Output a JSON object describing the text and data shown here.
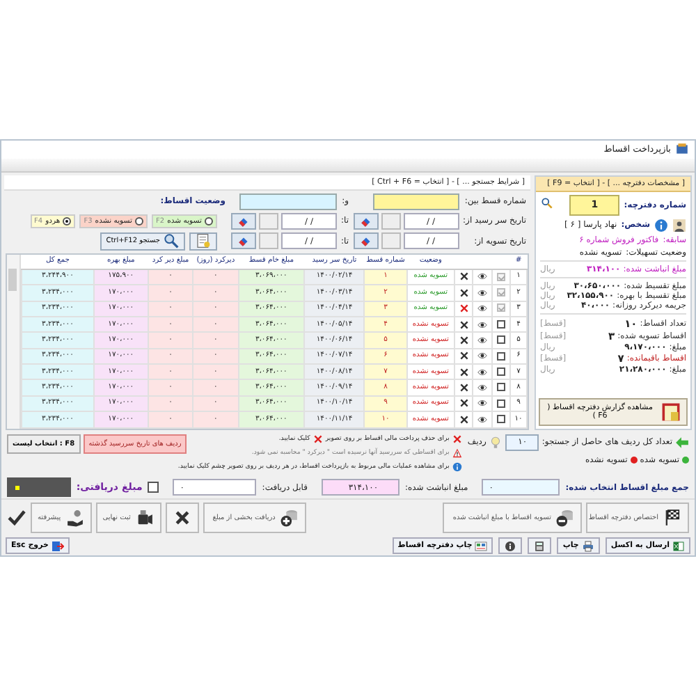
{
  "window": {
    "title": "بازپرداخت اقساط"
  },
  "booklet": {
    "header": "[ مشخصات دفترچه ... ] - [ انتخاب = F9 ]",
    "number_label": "شماره دفترچه:",
    "number": "1",
    "person_label": "شخص:",
    "person": "نهاد پارسا [ ۶ ]",
    "record_label": "سابقه:",
    "record": "فاکتور فروش شماره ۶",
    "status_label": "وضعیت تسهیلات:",
    "status": "تسویه نشده",
    "groups": [
      [
        {
          "label": "مبلغ انباشت شده:",
          "value": "۳۱۴،۱۰۰",
          "unit": "ریال",
          "kind": "accent"
        }
      ],
      [
        {
          "label": "مبلغ تقسیط شده:",
          "value": "۳۰،۶۵۰،۰۰۰",
          "unit": "ریال",
          "kind": "plain"
        },
        {
          "label": "مبلغ تقسیط با بهره:",
          "value": "۳۲،۱۵۵،۹۰۰",
          "unit": "ریال",
          "kind": "plain"
        },
        {
          "label": "جریمه دیرکرد روزانه:",
          "value": "۴۰،۰۰۰",
          "unit": "ریال",
          "kind": "plain"
        }
      ],
      [
        {
          "label": "تعداد اقساط:",
          "value": "۱۰",
          "unit": "[قسط]",
          "kind": "count"
        },
        {
          "label": "اقساط تسویه شده:",
          "value": "۳",
          "unit": "[قسط]",
          "kind": "count"
        },
        {
          "label": "مبلغ:",
          "value": "۹،۱۷۰،۰۰۰",
          "unit": "ریال",
          "kind": "plain"
        },
        {
          "label": "اقساط باقیمانده:",
          "value": "۷",
          "unit": "[قسط]",
          "kind": "warn"
        },
        {
          "label": "مبلغ:",
          "value": "۲۱،۲۸۰،۰۰۰",
          "unit": "ریال",
          "kind": "plain"
        }
      ]
    ],
    "report_button": "مشاهده گزارش دفترچه اقساط ( F6 )"
  },
  "search": {
    "header": "[ شرایط جستجو ... ] - [ انتخاب = Ctrl + F6 ]",
    "number_from_label": "شماره قسط بین:",
    "number_to_label": "و:",
    "status_label": "وضعیت اقساط:",
    "status_options": [
      {
        "label": "تسویه شده",
        "key": "F2",
        "color": "#d9f5c8",
        "selected": false
      },
      {
        "label": "تسویه نشده",
        "key": "F3",
        "color": "#fbd3c8",
        "selected": false
      },
      {
        "label": "هردو",
        "key": "F4",
        "color": "#fffbd0",
        "selected": true
      }
    ],
    "due_from_label": "تاریخ سر رسید از:",
    "due_from": "/  /",
    "due_to_label": "تا:",
    "due_to": "/  /",
    "settle_from_label": "تاریخ تسویه از:",
    "settle_from": "/  /",
    "settle_to_label": "تا:",
    "settle_to": "/  /",
    "search_button": {
      "label": "جستجو",
      "key": "Ctrl+F12"
    }
  },
  "table": {
    "columns": [
      "#",
      "وضعیت",
      "شماره قسط",
      "تاریخ سر رسید",
      "مبلغ خام قسط",
      "دیرکرد (روز)",
      "مبلغ دیر کرد",
      "مبلغ بهره",
      "جمع کل"
    ],
    "rows": [
      {
        "index": "۱",
        "checked": true,
        "settled": true,
        "current": false,
        "status": "تسویه شده",
        "number": "۱",
        "due": "۱۴۰۰/۰۲/۱۴",
        "raw": "۳،۰۶۹،۰۰۰",
        "delay": "۰",
        "late_fee": "۰",
        "interest": "۱۷۵،۹۰۰",
        "total": "۳،۲۴۴،۹۰۰"
      },
      {
        "index": "۲",
        "checked": true,
        "settled": true,
        "current": false,
        "status": "تسویه شده",
        "number": "۲",
        "due": "۱۴۰۰/۰۳/۱۴",
        "raw": "۳،۰۶۴،۰۰۰",
        "delay": "۰",
        "late_fee": "۰",
        "interest": "۱۷۰،۰۰۰",
        "total": "۳،۲۳۴،۰۰۰"
      },
      {
        "index": "۳",
        "checked": true,
        "settled": true,
        "current": true,
        "status": "تسویه شده",
        "number": "۳",
        "due": "۱۴۰۰/۰۴/۱۴",
        "raw": "۳،۰۶۴،۰۰۰",
        "delay": "۰",
        "late_fee": "۰",
        "interest": "۱۷۰،۰۰۰",
        "total": "۳،۲۳۴،۰۰۰"
      },
      {
        "index": "۴",
        "checked": false,
        "settled": false,
        "current": false,
        "status": "تسویه نشده",
        "number": "۴",
        "due": "۱۴۰۰/۰۵/۱۴",
        "raw": "۳،۰۶۴،۰۰۰",
        "delay": "۰",
        "late_fee": "۰",
        "interest": "۱۷۰،۰۰۰",
        "total": "۳،۲۳۴،۰۰۰"
      },
      {
        "index": "۵",
        "checked": false,
        "settled": false,
        "current": false,
        "status": "تسویه نشده",
        "number": "۵",
        "due": "۱۴۰۰/۰۶/۱۴",
        "raw": "۳،۰۶۴،۰۰۰",
        "delay": "۰",
        "late_fee": "۰",
        "interest": "۱۷۰،۰۰۰",
        "total": "۳،۲۳۴،۰۰۰"
      },
      {
        "index": "۶",
        "checked": false,
        "settled": false,
        "current": false,
        "status": "تسویه نشده",
        "number": "۶",
        "due": "۱۴۰۰/۰۷/۱۴",
        "raw": "۳،۰۶۴،۰۰۰",
        "delay": "۰",
        "late_fee": "۰",
        "interest": "۱۷۰،۰۰۰",
        "total": "۳،۲۳۴،۰۰۰"
      },
      {
        "index": "۷",
        "checked": false,
        "settled": false,
        "current": false,
        "status": "تسویه نشده",
        "number": "۷",
        "due": "۱۴۰۰/۰۸/۱۴",
        "raw": "۳،۰۶۴،۰۰۰",
        "delay": "۰",
        "late_fee": "۰",
        "interest": "۱۷۰،۰۰۰",
        "total": "۳،۲۳۴،۰۰۰"
      },
      {
        "index": "۸",
        "checked": false,
        "settled": false,
        "current": false,
        "status": "تسویه نشده",
        "number": "۸",
        "due": "۱۴۰۰/۰۹/۱۴",
        "raw": "۳،۰۶۴،۰۰۰",
        "delay": "۰",
        "late_fee": "۰",
        "interest": "۱۷۰،۰۰۰",
        "total": "۳،۲۳۴،۰۰۰"
      },
      {
        "index": "۹",
        "checked": false,
        "settled": false,
        "current": false,
        "status": "تسویه نشده",
        "number": "۹",
        "due": "۱۴۰۰/۱۰/۱۴",
        "raw": "۳،۰۶۴،۰۰۰",
        "delay": "۰",
        "late_fee": "۰",
        "interest": "۱۷۰،۰۰۰",
        "total": "۳،۲۳۴،۰۰۰"
      },
      {
        "index": "۱۰",
        "checked": false,
        "settled": false,
        "current": false,
        "status": "تسویه نشده",
        "number": "۱۰",
        "due": "۱۴۰۰/۱۱/۱۴",
        "raw": "۳،۰۶۴،۰۰۰",
        "delay": "۰",
        "late_fee": "۰",
        "interest": "۱۷۰،۰۰۰",
        "total": "۳،۲۳۴،۰۰۰"
      }
    ]
  },
  "result_count": {
    "label": "تعداد کل ردیف های حاصل از جستجو:",
    "value": "۱۰",
    "unit": "ردیف"
  },
  "legend": [
    {
      "label": "تسویه شده",
      "color": "#3cb43c"
    },
    {
      "label": "تسویه نشده",
      "color": "#e02020"
    }
  ],
  "hints": [
    {
      "kind": "delete",
      "before": "برای حذف پرداخت مالی اقساط بر روی تصویر",
      "after": "کلیک نمایید."
    },
    {
      "kind": "warning",
      "before": "برای اقساطی که سررسید آنها نرسیده است \" دیرکرد \" محاسبه نمی شود."
    },
    {
      "kind": "info",
      "before": "برای مشاهده عملیات مالی مربوط به بازپرداخت اقساط، در هر ردیف بر روی تصویر چشم کلیک نمایید."
    }
  ],
  "overdue_button": "ردیف های تاریخ سررسید گذشته",
  "select_list_button": "F8 : انتخاب لیست",
  "totals": {
    "selected_label": "جمع مبلغ اقساط انتخاب شده:",
    "selected": "۰",
    "accumulated_label": "مبلغ انباشت شده:",
    "accumulated": "۳۱۴،۱۰۰",
    "receivable_label": "قابل دریافت:",
    "receivable": "۰",
    "received_label": "مبلغ دریافتی:",
    "received_checked": false
  },
  "actions": [
    {
      "kind": "flag",
      "label": "اختصاص دفترچه اقساط"
    },
    {
      "kind": "coins-minus",
      "label": "تسویه اقساط با مبلغ انباشت شده"
    },
    {
      "kind": "coins-plus",
      "label": "دریافت بخشی از مبلغ"
    },
    {
      "kind": "cancel"
    },
    {
      "kind": "camera",
      "label": "ثبت نهایی"
    },
    {
      "kind": "hand",
      "label": "پیشرفته"
    },
    {
      "kind": "confirm"
    }
  ],
  "bottom": [
    {
      "kind": "excel",
      "label": "ارسال به اکسل"
    },
    {
      "kind": "print",
      "label": "چاپ"
    },
    {
      "kind": "calculator"
    },
    {
      "kind": "help"
    },
    {
      "kind": "booklet",
      "label": "چاپ دفترچه اقساط"
    }
  ],
  "exit": {
    "label": "خروج",
    "key": "Esc"
  }
}
